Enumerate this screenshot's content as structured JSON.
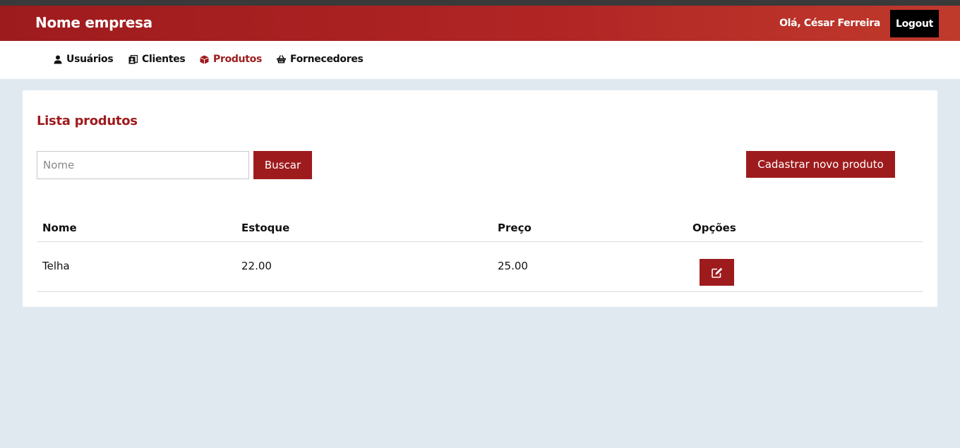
{
  "header": {
    "brand": "Nome empresa",
    "greeting": "Olá, César Ferreira",
    "logout_label": "Logout"
  },
  "nav": {
    "items": [
      {
        "label": "Usuários",
        "icon": "user-icon",
        "active": false
      },
      {
        "label": "Clientes",
        "icon": "address-book-icon",
        "active": false
      },
      {
        "label": "Produtos",
        "icon": "box-icon",
        "active": true
      },
      {
        "label": "Fornecedores",
        "icon": "basket-icon",
        "active": false
      }
    ]
  },
  "page": {
    "title": "Lista produtos",
    "search": {
      "placeholder": "Nome",
      "value": ""
    },
    "search_button": "Buscar",
    "new_button": "Cadastrar novo produto"
  },
  "table": {
    "columns": [
      "Nome",
      "Estoque",
      "Preço",
      "Opções"
    ],
    "rows": [
      {
        "nome": "Telha",
        "estoque": "22.00",
        "preco": "25.00",
        "action_icon": "edit-icon"
      }
    ]
  },
  "colors": {
    "brand": "#9e1b1d",
    "background": "#e0e9ef"
  }
}
